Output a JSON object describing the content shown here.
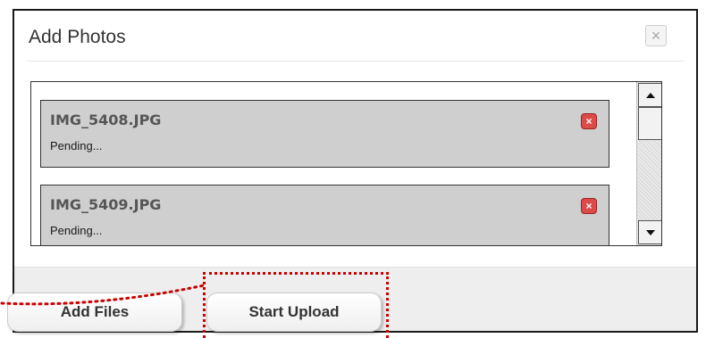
{
  "dialog": {
    "title": "Add Photos",
    "close_glyph": "×"
  },
  "queue": {
    "files": [
      {
        "name": "IMG_5408.JPG",
        "status": "Pending...",
        "remove_glyph": "×"
      },
      {
        "name": "IMG_5409.JPG",
        "status": "Pending...",
        "remove_glyph": "×"
      }
    ]
  },
  "footer": {
    "add_files_label": "Add Files",
    "start_upload_label": "Start Upload"
  },
  "annotation": {
    "color": "#cc0000",
    "style": "dotted"
  },
  "icons": {
    "close": "close-icon",
    "remove": "remove-file-icon",
    "scroll_up": "arrow-up-icon",
    "scroll_down": "arrow-down-icon"
  }
}
